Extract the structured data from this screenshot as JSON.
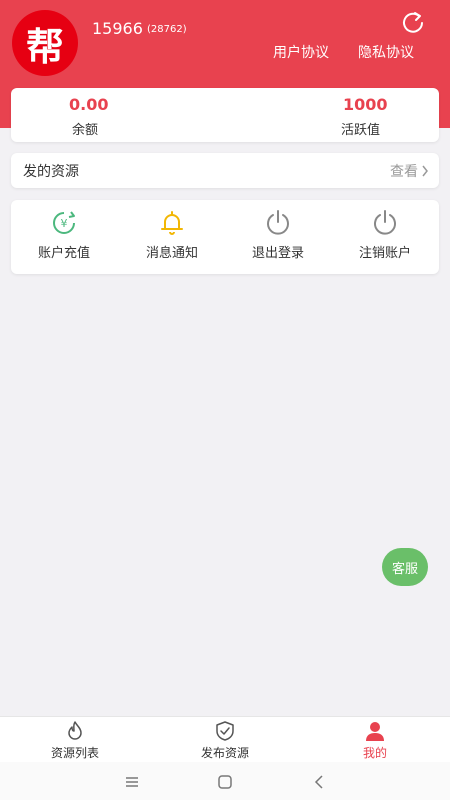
{
  "header": {
    "logo_text": "帮",
    "phone": "15966",
    "uid": "(28762)",
    "user_agreement": "用户协议",
    "privacy_agreement": "隐私协议"
  },
  "stats": {
    "balance_value": "0.00",
    "balance_label": "余额",
    "activity_value": "1000",
    "activity_label": "活跃值"
  },
  "resources": {
    "title": "发的资源",
    "view_label": "查看"
  },
  "actions": [
    {
      "label": "账户充值",
      "icon": "recharge-icon"
    },
    {
      "label": "消息通知",
      "icon": "bell-icon"
    },
    {
      "label": "退出登录",
      "icon": "power-icon"
    },
    {
      "label": "注销账户",
      "icon": "power-icon"
    }
  ],
  "service_button": "客服",
  "tabs": [
    {
      "label": "资源列表",
      "icon": "flame-icon"
    },
    {
      "label": "发布资源",
      "icon": "shield-check-icon"
    },
    {
      "label": "我的",
      "icon": "user-icon",
      "active": true
    }
  ],
  "colors": {
    "brand_red": "#e8424f",
    "logo_red": "#e60012",
    "service_green": "#6abf69",
    "recharge_green": "#4cb87e",
    "bell_yellow": "#f2b705"
  }
}
